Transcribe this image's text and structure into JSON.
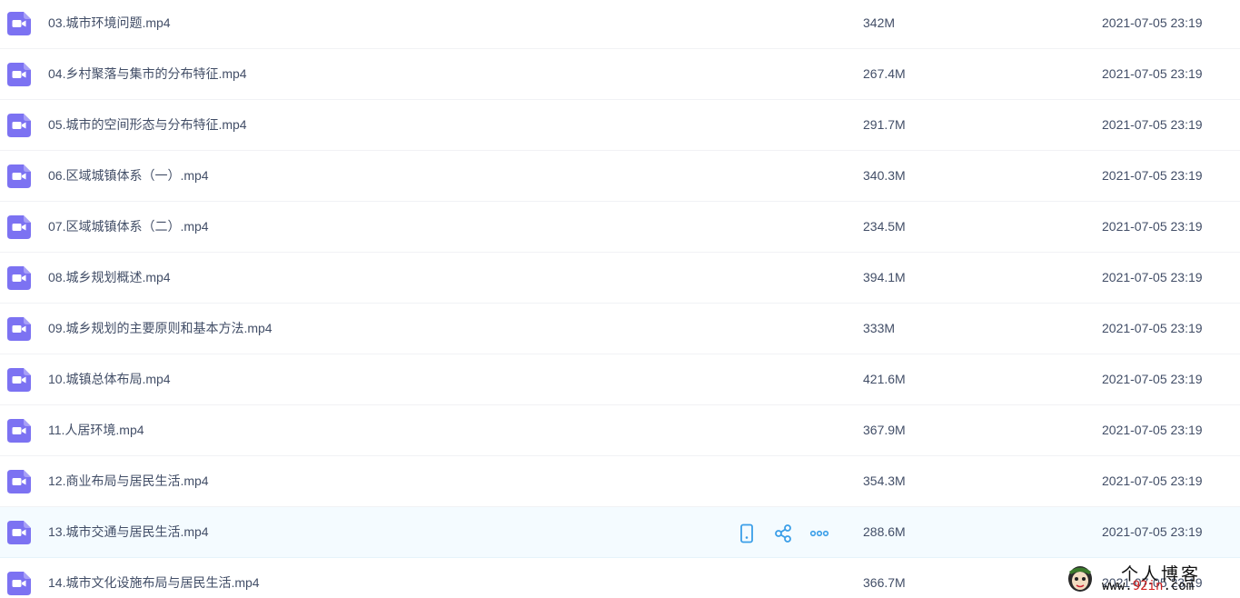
{
  "files": [
    {
      "name": "03.城市环境问题.mp4",
      "size": "342M",
      "modified": "2021-07-05 23:19",
      "icon": "video-file-icon"
    },
    {
      "name": "04.乡村聚落与集市的分布特征.mp4",
      "size": "267.4M",
      "modified": "2021-07-05 23:19",
      "icon": "video-file-icon"
    },
    {
      "name": "05.城市的空间形态与分布特征.mp4",
      "size": "291.7M",
      "modified": "2021-07-05 23:19",
      "icon": "video-file-icon"
    },
    {
      "name": "06.区域城镇体系（一）.mp4",
      "size": "340.3M",
      "modified": "2021-07-05 23:19",
      "icon": "video-file-icon"
    },
    {
      "name": "07.区域城镇体系（二）.mp4",
      "size": "234.5M",
      "modified": "2021-07-05 23:19",
      "icon": "video-file-icon"
    },
    {
      "name": "08.城乡规划概述.mp4",
      "size": "394.1M",
      "modified": "2021-07-05 23:19",
      "icon": "video-file-icon"
    },
    {
      "name": "09.城乡规划的主要原则和基本方法.mp4",
      "size": "333M",
      "modified": "2021-07-05 23:19",
      "icon": "video-file-icon"
    },
    {
      "name": "10.城镇总体布局.mp4",
      "size": "421.6M",
      "modified": "2021-07-05 23:19",
      "icon": "video-file-icon"
    },
    {
      "name": "11.人居环境.mp4",
      "size": "367.9M",
      "modified": "2021-07-05 23:19",
      "icon": "video-file-icon"
    },
    {
      "name": "12.商业布局与居民生活.mp4",
      "size": "354.3M",
      "modified": "2021-07-05 23:19",
      "icon": "video-file-icon"
    },
    {
      "name": "13.城市交通与居民生活.mp4",
      "size": "288.6M",
      "modified": "2021-07-05 23:19",
      "icon": "video-file-icon",
      "hovered": true
    },
    {
      "name": "14.城市文化设施布局与居民生活.mp4",
      "size": "366.7M",
      "modified": "2021-07-05 23:19",
      "icon": "video-file-icon"
    }
  ],
  "row_actions": [
    {
      "icon": "phone-icon",
      "name": "send-to-phone-button"
    },
    {
      "icon": "share-icon",
      "name": "share-button"
    },
    {
      "icon": "more-icon",
      "name": "more-button"
    }
  ],
  "watermark": {
    "title": "个人博客",
    "url_prefix": "www.",
    "url_highlight": "92in",
    "url_suffix": ".com"
  },
  "colors": {
    "icon_purple": "#7c72f2",
    "text": "#424e67",
    "hover_bg": "#f4fbff",
    "action_blue": "#3a9ee8",
    "divider": "#f1f2f5"
  }
}
